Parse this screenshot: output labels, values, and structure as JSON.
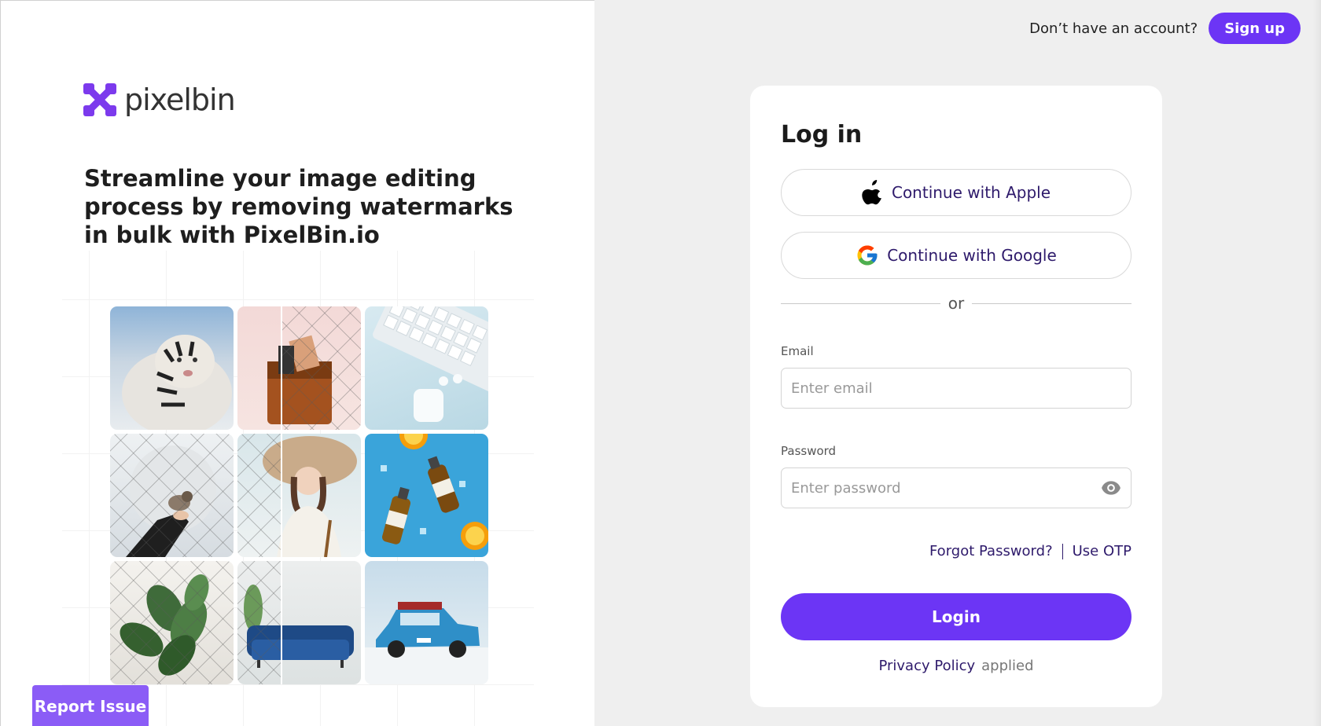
{
  "brand": {
    "name": "pixelbin",
    "accent": "#6c35f5",
    "logo_color": "#7c3aed"
  },
  "left": {
    "headline": "Streamline your image editing process by removing watermarks in bulk with PixelBin.io",
    "report_issue": "Report Issue"
  },
  "topbar": {
    "question": "Don’t have an account?",
    "signup": "Sign up"
  },
  "login": {
    "title": "Log in",
    "apple": "Continue with Apple",
    "google": "Continue with Google",
    "or": "or",
    "email_label": "Email",
    "email_placeholder": "Enter email",
    "password_label": "Password",
    "password_placeholder": "Enter password",
    "forgot": "Forgot Password?",
    "otp": "Use OTP",
    "submit": "Login",
    "privacy": "Privacy Policy",
    "applied": "applied"
  }
}
